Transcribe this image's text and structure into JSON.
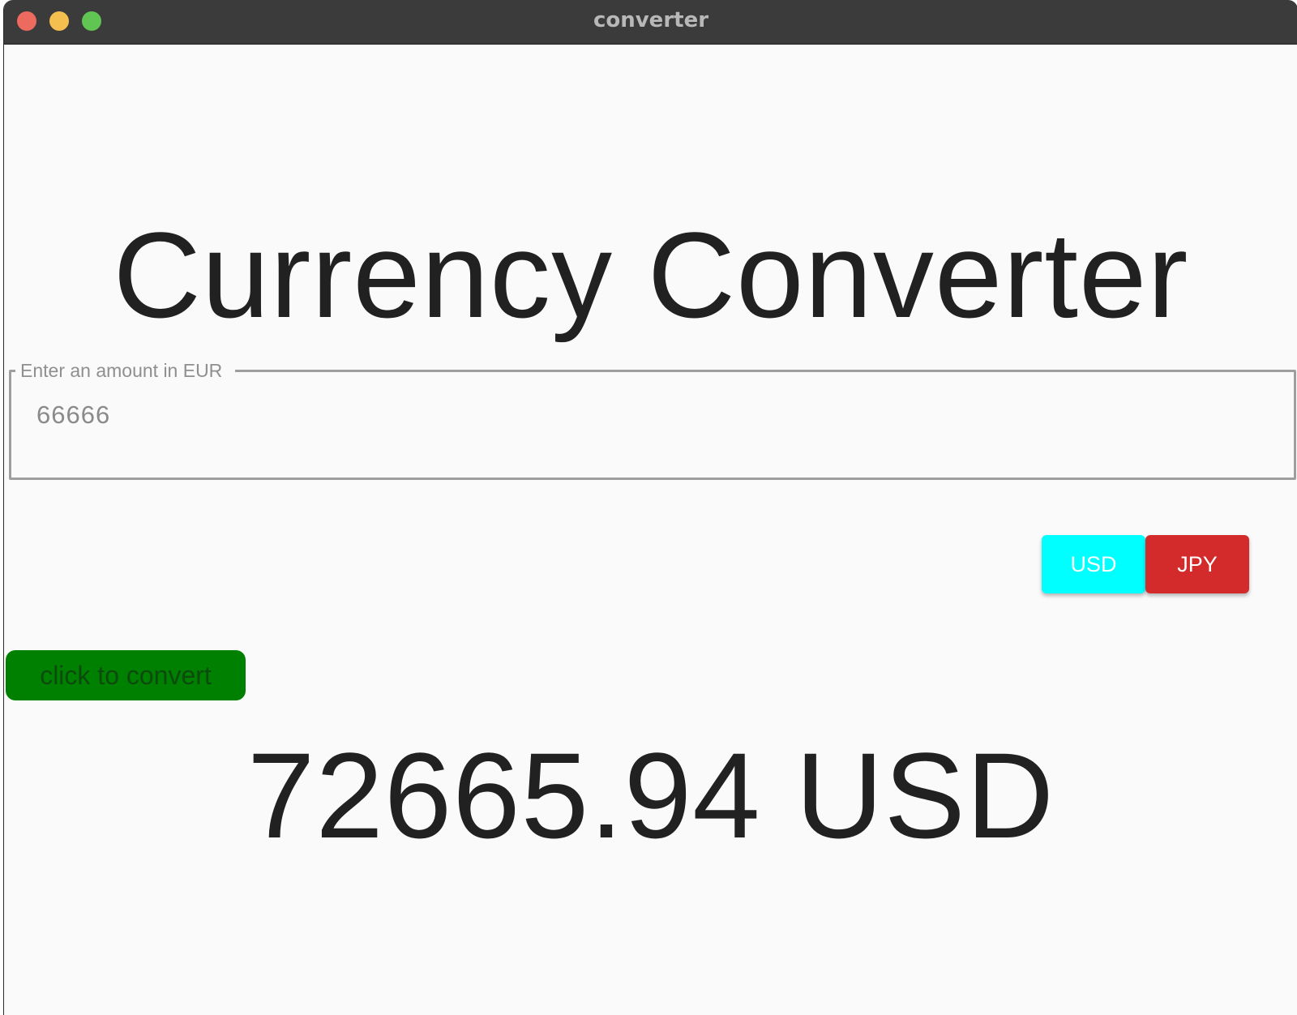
{
  "window": {
    "title": "converter"
  },
  "app": {
    "heading": "Currency Converter",
    "amount_field": {
      "label": "Enter an amount in EUR",
      "value": "66666"
    },
    "currency_buttons": [
      {
        "label": "USD",
        "color": "#00ffff"
      },
      {
        "label": "JPY",
        "color": "#d32b2b"
      }
    ],
    "convert_button": {
      "label": "click to convert",
      "color": "#008000"
    },
    "result": "72665.94 USD"
  },
  "icons": [
    "close-icon",
    "minimize-icon",
    "maximize-icon"
  ]
}
